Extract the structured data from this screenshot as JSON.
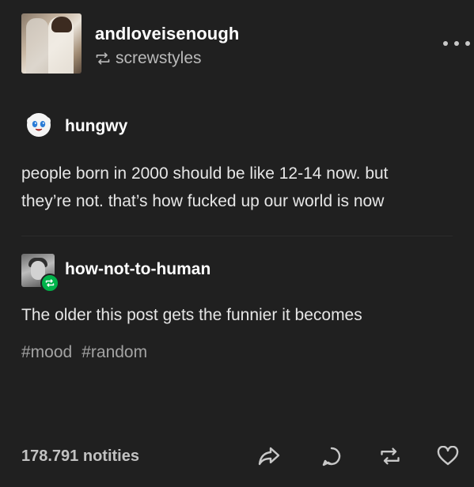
{
  "header": {
    "blog_name": "andloveisenough",
    "reblogged_from": "screwstyles"
  },
  "posts": [
    {
      "username": "hungwy",
      "body": "people born in 2000 should be like 12-14 now. but\nthey’re not. that’s how fucked up our world is now"
    },
    {
      "username": "how-not-to-human",
      "body": "The older this post gets the funnier it becomes",
      "tags": [
        "#mood",
        "#random"
      ]
    }
  ],
  "footer": {
    "notes": "178.791 notities"
  },
  "colors": {
    "background": "#202020",
    "reblog_badge": "#00b34a"
  },
  "icons": {
    "reblog": "reblog-icon",
    "share": "share-icon",
    "reply": "reply-icon",
    "like": "heart-icon",
    "more": "more-icon"
  }
}
